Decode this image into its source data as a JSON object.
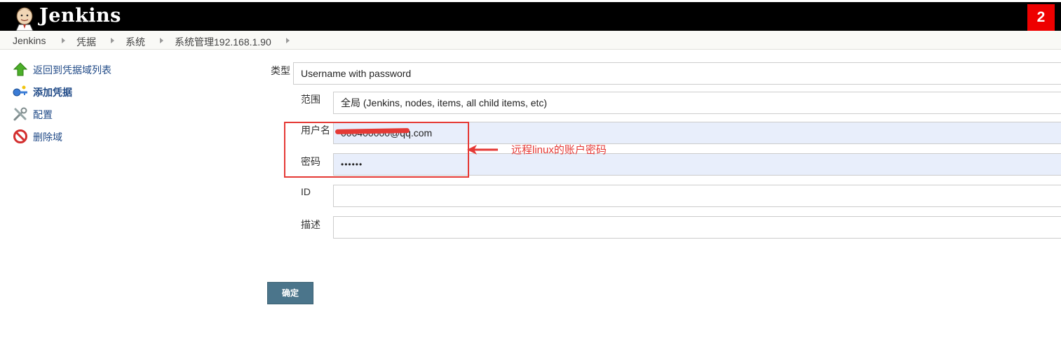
{
  "header": {
    "brand": "Jenkins",
    "badge": "2"
  },
  "breadcrumbs": [
    "Jenkins",
    "凭据",
    "系统",
    "系统管理192.168.1.90"
  ],
  "sidebar": {
    "items": [
      {
        "label": "返回到凭据域列表",
        "icon": "up-arrow-icon"
      },
      {
        "label": "添加凭据",
        "icon": "key-icon"
      },
      {
        "label": "配置",
        "icon": "tools-icon"
      },
      {
        "label": "删除域",
        "icon": "no-entry-icon"
      }
    ]
  },
  "form": {
    "kind": {
      "label": "类型",
      "value": "Username with password"
    },
    "scope": {
      "label": "范围",
      "value": "全局 (Jenkins, nodes, items, all child items, etc)"
    },
    "username": {
      "label": "用户名",
      "value": "000400000@qq.com"
    },
    "password": {
      "label": "密码",
      "value": "••••••"
    },
    "id": {
      "label": "ID",
      "value": ""
    },
    "description": {
      "label": "描述",
      "value": ""
    },
    "submit_label": "确定"
  },
  "annotation": {
    "text": "远程linux的账户密码",
    "color": "#e53935"
  },
  "colors": {
    "header_bg": "#000000",
    "badge_bg": "#ee0000",
    "link": "#204a87",
    "submit_bg": "#4b758b",
    "filled_field": "#e8eefb"
  }
}
